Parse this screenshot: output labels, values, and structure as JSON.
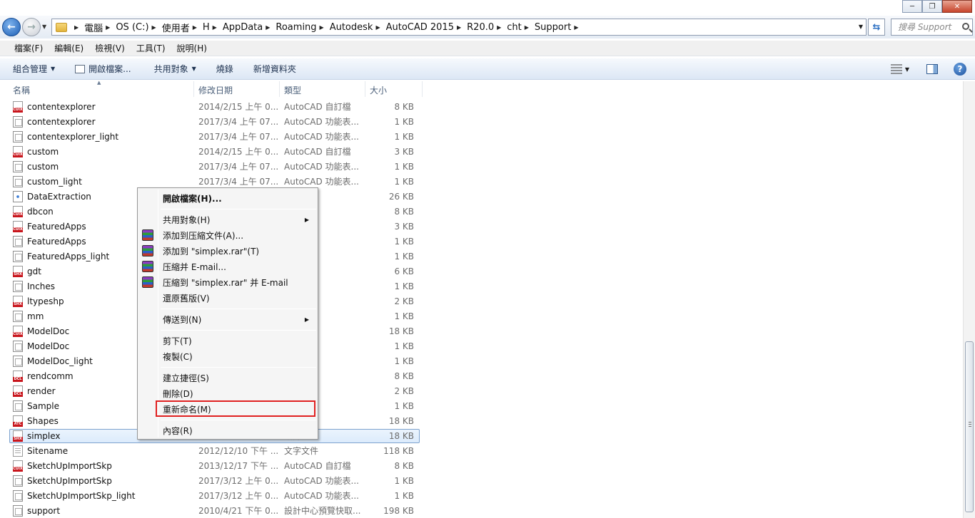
{
  "window": {
    "minimize": "─",
    "maximize": "❐",
    "close": "✕"
  },
  "address": {
    "crumbs": [
      "電腦",
      "OS (C:)",
      "使用者",
      "H",
      "AppData",
      "Roaming",
      "Autodesk",
      "AutoCAD 2015",
      "R20.0",
      "cht",
      "Support"
    ],
    "search_placeholder": "搜尋 Support"
  },
  "menu": {
    "items": [
      "檔案(F)",
      "編輯(E)",
      "檢視(V)",
      "工具(T)",
      "說明(H)"
    ]
  },
  "commands": {
    "organize": "組合管理",
    "open": "開啟檔案...",
    "share": "共用對象",
    "burn": "燒錄",
    "new_folder": "新增資料夾"
  },
  "columns": {
    "name": "名稱",
    "date": "修改日期",
    "type": "類型",
    "size": "大小"
  },
  "files": [
    {
      "name": "contentexplorer",
      "date": "2014/2/15 上午 0...",
      "type": "AutoCAD 自訂檔",
      "size": "8 KB",
      "icon": "cuix"
    },
    {
      "name": "contentexplorer",
      "date": "2017/3/4 上午 07...",
      "type": "AutoCAD 功能表...",
      "size": "1 KB",
      "icon": "menu"
    },
    {
      "name": "contentexplorer_light",
      "date": "2017/3/4 上午 07...",
      "type": "AutoCAD 功能表...",
      "size": "1 KB",
      "icon": "menu"
    },
    {
      "name": "custom",
      "date": "2014/2/15 上午 0...",
      "type": "AutoCAD 自訂檔",
      "size": "3 KB",
      "icon": "cuix"
    },
    {
      "name": "custom",
      "date": "2017/3/4 上午 07...",
      "type": "AutoCAD 功能表...",
      "size": "1 KB",
      "icon": "menu"
    },
    {
      "name": "custom_light",
      "date": "2017/3/4 上午 07...",
      "type": "AutoCAD 功能表...",
      "size": "1 KB",
      "icon": "menu"
    },
    {
      "name": "DataExtraction",
      "date": "",
      "type": "cument",
      "size": "26 KB",
      "icon": "xml"
    },
    {
      "name": "dbcon",
      "date": "",
      "type": "自訂檔",
      "size": "8 KB",
      "icon": "cuix"
    },
    {
      "name": "FeaturedApps",
      "date": "",
      "type": "自訂檔",
      "size": "3 KB",
      "icon": "cuix"
    },
    {
      "name": "FeaturedApps",
      "date": "",
      "type": "功能表...",
      "size": "1 KB",
      "icon": "menu"
    },
    {
      "name": "FeaturedApps_light",
      "date": "",
      "type": "功能表...",
      "size": "1 KB",
      "icon": "menu"
    },
    {
      "name": "gdt",
      "date": "",
      "type": "編譯造型",
      "size": "6 KB",
      "icon": "shx"
    },
    {
      "name": "Inches",
      "date": "",
      "type": "出圖戳...",
      "size": "1 KB",
      "icon": "menu"
    },
    {
      "name": "ltypeshp",
      "date": "",
      "type": "編譯造型",
      "size": "2 KB",
      "icon": "shx"
    },
    {
      "name": "mm",
      "date": "",
      "type": "出圖戳...",
      "size": "1 KB",
      "icon": "menu"
    },
    {
      "name": "ModelDoc",
      "date": "",
      "type": "自訂檔",
      "size": "18 KB",
      "icon": "cuix"
    },
    {
      "name": "ModelDoc",
      "date": "",
      "type": "功能表...",
      "size": "1 KB",
      "icon": "menu"
    },
    {
      "name": "ModelDoc_light",
      "date": "",
      "type": "功能表...",
      "size": "1 KB",
      "icon": "menu"
    },
    {
      "name": "rendcomm",
      "date": "",
      "type": "對話方...",
      "size": "8 KB",
      "icon": "dcl"
    },
    {
      "name": "render",
      "date": "",
      "type": "對話方...",
      "size": "2 KB",
      "icon": "dcl"
    },
    {
      "name": "Sample",
      "date": "",
      "type": "自訂字典",
      "size": "1 KB",
      "icon": "menu"
    },
    {
      "name": "Shapes",
      "date": "",
      "type": "工具目錄",
      "size": "18 KB",
      "icon": "atc"
    },
    {
      "name": "simplex",
      "date": "",
      "type": "編譯造型",
      "size": "18 KB",
      "icon": "shx",
      "selected": true
    },
    {
      "name": "Sitename",
      "date": "2012/12/10 下午 ...",
      "type": "文字文件",
      "size": "118 KB",
      "icon": "txt"
    },
    {
      "name": "SketchUpImportSkp",
      "date": "2013/12/17 下午 ...",
      "type": "AutoCAD 自訂檔",
      "size": "8 KB",
      "icon": "cuix"
    },
    {
      "name": "SketchUpImportSkp",
      "date": "2017/3/12 上午 0...",
      "type": "AutoCAD 功能表...",
      "size": "1 KB",
      "icon": "menu"
    },
    {
      "name": "SketchUpImportSkp_light",
      "date": "2017/3/12 上午 0...",
      "type": "AutoCAD 功能表...",
      "size": "1 KB",
      "icon": "menu"
    },
    {
      "name": "support",
      "date": "2010/4/21 下午 0...",
      "type": "設計中心預覽快取...",
      "size": "198 KB",
      "icon": "menu"
    }
  ],
  "context_menu": {
    "open": "開啟檔案(H)...",
    "share": "共用對象(H)",
    "add_archive": "添加到压縮文件(A)...",
    "add_rar": "添加到 \"simplex.rar\"(T)",
    "compress_email": "压縮并 E-mail...",
    "compress_rar_email": "压縮到 \"simplex.rar\" 并 E-mail",
    "restore": "還原舊版(V)",
    "send_to": "傳送到(N)",
    "cut": "剪下(T)",
    "copy": "複製(C)",
    "shortcut": "建立捷徑(S)",
    "delete": "刪除(D)",
    "rename": "重新命名(M)",
    "properties": "內容(R)"
  },
  "colors": {
    "highlight": "#e02020",
    "selection": "#dcebfc",
    "accent": "#1e5fb4"
  }
}
